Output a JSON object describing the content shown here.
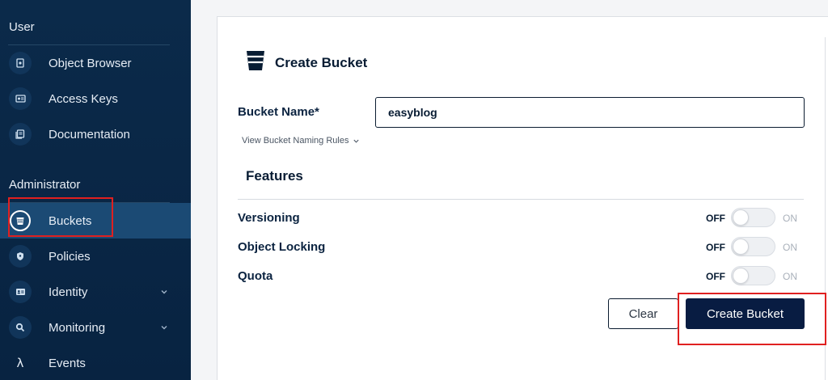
{
  "sidebar": {
    "user_section": "User",
    "admin_section": "Administrator",
    "items": [
      {
        "label": "Object Browser",
        "icon": "object-browser-icon"
      },
      {
        "label": "Access Keys",
        "icon": "access-keys-icon"
      },
      {
        "label": "Documentation",
        "icon": "documentation-icon"
      },
      {
        "label": "Buckets",
        "icon": "bucket-icon",
        "active": true
      },
      {
        "label": "Policies",
        "icon": "shield-icon"
      },
      {
        "label": "Identity",
        "icon": "identity-card-icon",
        "expandable": true
      },
      {
        "label": "Monitoring",
        "icon": "magnifier-icon",
        "expandable": true
      },
      {
        "label": "Events",
        "icon": "lambda-icon"
      }
    ]
  },
  "form": {
    "title": "Create Bucket",
    "bucket_name_label": "Bucket Name*",
    "bucket_name_value": "easyblog",
    "naming_rules_link": "View Bucket Naming Rules",
    "features_heading": "Features",
    "features": [
      {
        "label": "Versioning",
        "off": "OFF",
        "on": "ON",
        "enabled": false
      },
      {
        "label": "Object Locking",
        "off": "OFF",
        "on": "ON",
        "enabled": false
      },
      {
        "label": "Quota",
        "off": "OFF",
        "on": "ON",
        "enabled": false
      }
    ],
    "clear_button": "Clear",
    "create_button": "Create Bucket"
  },
  "colors": {
    "sidebar_bg": "#0b2a4a",
    "sidebar_active": "#1b4a74",
    "primary_button": "#081c42",
    "highlight": "#e02020"
  }
}
